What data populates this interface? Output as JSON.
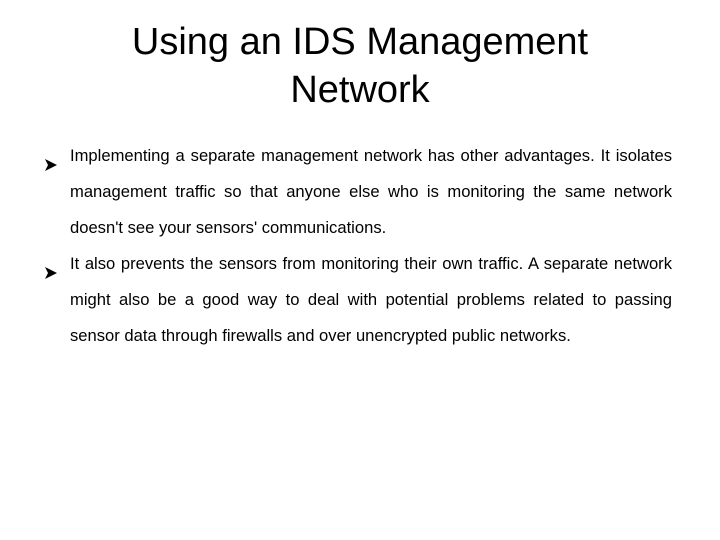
{
  "slide": {
    "title": "Using an IDS Management Network",
    "bullets": [
      {
        "icon": "arrowhead-bullet-icon",
        "text": "Implementing a separate management network has other advantages. It isolates management traffic so that anyone else who is monitoring the same network doesn't see your sensors' communications."
      },
      {
        "icon": "arrowhead-bullet-icon",
        "text": " It also prevents the sensors from monitoring their own traffic. A separate network might also be a good way to deal with potential problems related to passing sensor data through firewalls and over unencrypted public networks."
      }
    ]
  }
}
